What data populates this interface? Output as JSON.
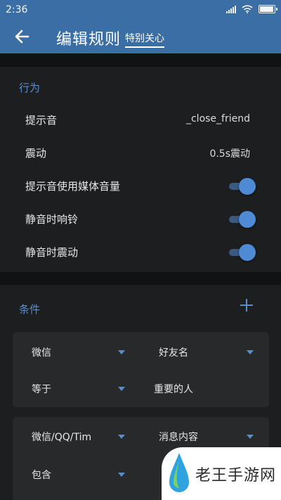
{
  "status_bar": {
    "time": "2:36"
  },
  "app_bar": {
    "title": "编辑规则",
    "rule_name": "特别关心"
  },
  "behavior": {
    "title": "行为",
    "rows": [
      {
        "label": "提示音",
        "value": "_close_friend"
      },
      {
        "label": "震动",
        "value": "0.5s震动"
      },
      {
        "label": "提示音使用媒体音量",
        "toggle": true
      },
      {
        "label": "静音时响铃",
        "toggle": true
      },
      {
        "label": "静音时震动",
        "toggle": true
      }
    ]
  },
  "conditions": {
    "title": "条件",
    "items": [
      {
        "app": "微信",
        "field": "好友名",
        "operator": "等于",
        "value": "重要的人"
      },
      {
        "app": "微信/QQ/Tim",
        "field": "消息内容",
        "operator": "包含",
        "value": ""
      }
    ]
  },
  "watermark": {
    "text": "老王手游网"
  },
  "colors": {
    "primary": "#3b6ea5",
    "accent": "#5a8ecb",
    "switch_on": "#4f8ad4",
    "background": "#111214",
    "surface": "#1d1e20",
    "card": "#28292b"
  }
}
